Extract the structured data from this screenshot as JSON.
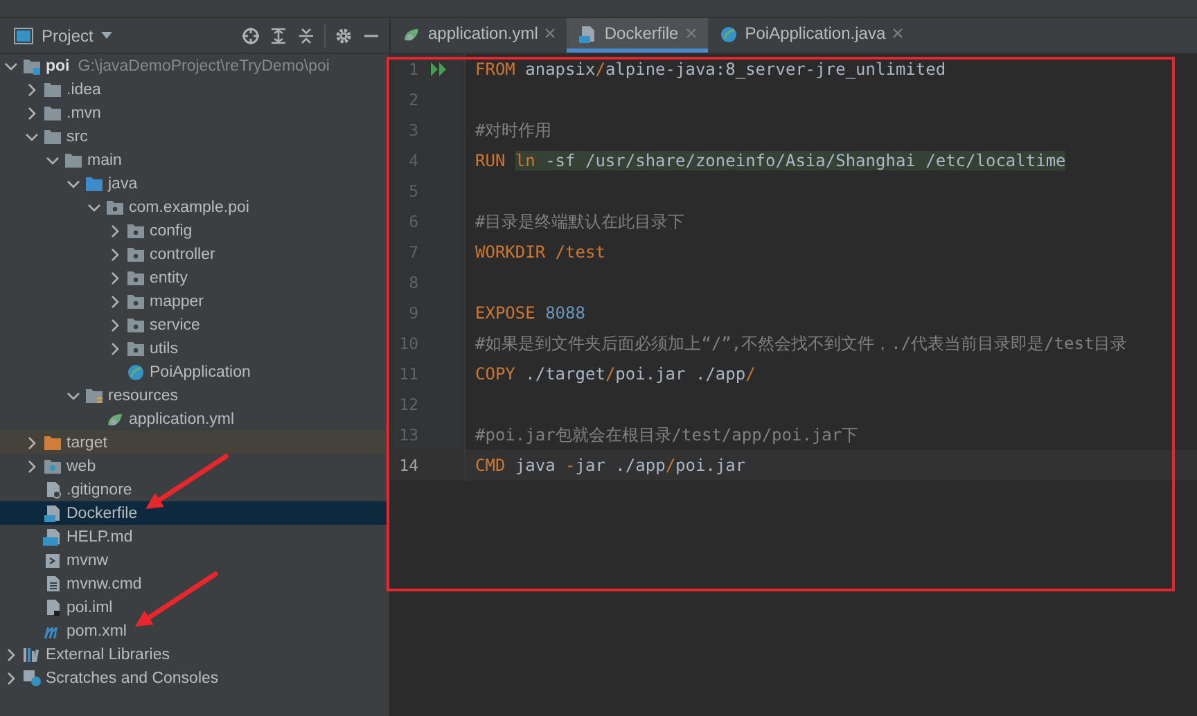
{
  "project_panel": {
    "title": "Project",
    "tree": [
      {
        "label": "poi",
        "kind": "module",
        "path": "G:\\javaDemoProject\\reTryDemo\\poi",
        "expanded": true,
        "selected": false,
        "arrow": false,
        "children": [
          {
            "label": ".idea",
            "kind": "folder",
            "expanded": false,
            "selected": false,
            "arrow": false
          },
          {
            "label": ".mvn",
            "kind": "folder",
            "expanded": false,
            "selected": false,
            "arrow": false
          },
          {
            "label": "src",
            "kind": "folder",
            "expanded": true,
            "selected": false,
            "arrow": false,
            "children": [
              {
                "label": "main",
                "kind": "folder",
                "expanded": true,
                "selected": false,
                "arrow": false,
                "children": [
                  {
                    "label": "java",
                    "kind": "source-folder",
                    "expanded": true,
                    "selected": false,
                    "arrow": false,
                    "children": [
                      {
                        "label": "com.example.poi",
                        "kind": "package",
                        "expanded": true,
                        "selected": false,
                        "arrow": false,
                        "children": [
                          {
                            "label": "config",
                            "kind": "package",
                            "expanded": false,
                            "selected": false,
                            "arrow": false
                          },
                          {
                            "label": "controller",
                            "kind": "package",
                            "expanded": false,
                            "selected": false,
                            "arrow": false
                          },
                          {
                            "label": "entity",
                            "kind": "package",
                            "expanded": false,
                            "selected": false,
                            "arrow": false
                          },
                          {
                            "label": "mapper",
                            "kind": "package",
                            "expanded": false,
                            "selected": false,
                            "arrow": false
                          },
                          {
                            "label": "service",
                            "kind": "package",
                            "expanded": false,
                            "selected": false,
                            "arrow": false
                          },
                          {
                            "label": "utils",
                            "kind": "package",
                            "expanded": false,
                            "selected": false,
                            "arrow": false
                          },
                          {
                            "label": "PoiApplication",
                            "kind": "app-class",
                            "selected": false,
                            "arrow": false
                          }
                        ]
                      }
                    ]
                  },
                  {
                    "label": "resources",
                    "kind": "resources",
                    "expanded": true,
                    "selected": false,
                    "arrow": false,
                    "children": [
                      {
                        "label": "application.yml",
                        "kind": "yml",
                        "selected": false,
                        "arrow": false
                      }
                    ]
                  }
                ]
              }
            ]
          },
          {
            "label": "target",
            "kind": "excluded-folder",
            "expanded": false,
            "selected": false,
            "arrow": false
          },
          {
            "label": "web",
            "kind": "web-folder",
            "expanded": false,
            "selected": false,
            "arrow": false
          },
          {
            "label": ".gitignore",
            "kind": "ignore-file",
            "selected": false,
            "arrow": false
          },
          {
            "label": "Dockerfile",
            "kind": "docker-file",
            "selected": true,
            "arrow": true
          },
          {
            "label": "HELP.md",
            "kind": "markdown",
            "selected": false,
            "arrow": false
          },
          {
            "label": "mvnw",
            "kind": "script",
            "selected": false,
            "arrow": false
          },
          {
            "label": "mvnw.cmd",
            "kind": "text",
            "selected": false,
            "arrow": false
          },
          {
            "label": "poi.iml",
            "kind": "iml",
            "selected": false,
            "arrow": false
          },
          {
            "label": "pom.xml",
            "kind": "maven",
            "selected": false,
            "arrow": true
          }
        ]
      },
      {
        "label": "External Libraries",
        "kind": "libraries",
        "expanded": false,
        "selected": false,
        "arrow": false
      },
      {
        "label": "Scratches and Consoles",
        "kind": "scratches",
        "expanded": false,
        "selected": false,
        "arrow": false
      }
    ]
  },
  "editor": {
    "outlined": true,
    "tabs": [
      {
        "label": "application.yml",
        "kind": "yml",
        "selected": false
      },
      {
        "label": "Dockerfile",
        "kind": "docker-file",
        "selected": true
      },
      {
        "label": "PoiApplication.java",
        "kind": "app-class",
        "selected": false
      }
    ],
    "lines": [
      {
        "number": "1",
        "run_marker": true,
        "current": false,
        "segments": [
          {
            "kind": "keyword",
            "text": "FROM",
            "highlighted": false
          },
          {
            "kind": "text",
            "text": " anapsix",
            "highlighted": false
          },
          {
            "kind": "operator",
            "text": "/",
            "highlighted": false
          },
          {
            "kind": "text",
            "text": "alpine-java:8_server-jre_unlimited",
            "highlighted": false
          }
        ]
      },
      {
        "number": "2",
        "current": false
      },
      {
        "number": "3",
        "current": false,
        "segments": [
          {
            "kind": "comment",
            "text": "#对时作用",
            "highlighted": false
          }
        ]
      },
      {
        "number": "4",
        "current": false,
        "segments": [
          {
            "kind": "keyword",
            "text": "RUN ",
            "highlighted": false
          },
          {
            "kind": "keyword",
            "text": "ln",
            "highlighted": true
          },
          {
            "kind": "text",
            "text": " -sf /usr/share/zoneinfo/Asia/Shanghai /etc/localtime",
            "highlighted": true
          }
        ]
      },
      {
        "number": "5",
        "current": false
      },
      {
        "number": "6",
        "current": false,
        "segments": [
          {
            "kind": "comment",
            "text": "#目录是终端默认在此目录下",
            "highlighted": false
          }
        ]
      },
      {
        "number": "7",
        "current": false,
        "segments": [
          {
            "kind": "keyword",
            "text": "WORKDIR /test",
            "highlighted": false
          }
        ]
      },
      {
        "number": "8",
        "current": false
      },
      {
        "number": "9",
        "current": false,
        "segments": [
          {
            "kind": "keyword",
            "text": "EXPOSE ",
            "highlighted": false
          },
          {
            "kind": "number",
            "text": "8088",
            "highlighted": false
          }
        ]
      },
      {
        "number": "10",
        "current": false,
        "segments": [
          {
            "kind": "comment",
            "text": "#如果是到文件夹后面必须加上“/”,不然会找不到文件，./代表当前目录即是/test目录",
            "highlighted": false
          }
        ]
      },
      {
        "number": "11",
        "current": false,
        "segments": [
          {
            "kind": "keyword",
            "text": "COPY",
            "highlighted": false
          },
          {
            "kind": "text",
            "text": " ./target",
            "highlighted": false
          },
          {
            "kind": "operator",
            "text": "/",
            "highlighted": false
          },
          {
            "kind": "text",
            "text": "poi.jar ./app",
            "highlighted": false
          },
          {
            "kind": "operator",
            "text": "/",
            "highlighted": false
          }
        ]
      },
      {
        "number": "12",
        "current": false
      },
      {
        "number": "13",
        "current": false,
        "segments": [
          {
            "kind": "comment",
            "text": "#poi.jar包就会在根目录/test/app/poi.jar下",
            "highlighted": false
          }
        ]
      },
      {
        "number": "14",
        "current": true,
        "segments": [
          {
            "kind": "keyword",
            "text": "CMD",
            "highlighted": false
          },
          {
            "kind": "text",
            "text": " java ",
            "highlighted": false
          },
          {
            "kind": "operator",
            "text": "-",
            "highlighted": false
          },
          {
            "kind": "text",
            "text": "jar ./app",
            "highlighted": false
          },
          {
            "kind": "operator",
            "text": "/",
            "highlighted": false
          },
          {
            "kind": "text",
            "text": "poi.jar",
            "highlighted": false
          }
        ]
      }
    ]
  }
}
